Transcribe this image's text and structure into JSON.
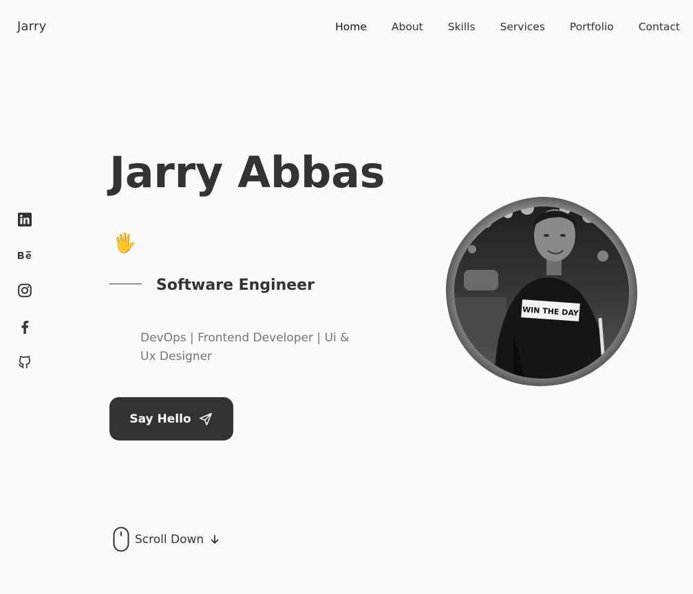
{
  "header": {
    "logo": "Jarry",
    "nav": [
      {
        "label": "Home",
        "active": true
      },
      {
        "label": "About",
        "active": false
      },
      {
        "label": "Skills",
        "active": false
      },
      {
        "label": "Services",
        "active": false
      },
      {
        "label": "Portfolio",
        "active": false
      },
      {
        "label": "Contact",
        "active": false
      }
    ]
  },
  "socials": [
    {
      "icon": "linkedin-icon"
    },
    {
      "icon": "behance-icon"
    },
    {
      "icon": "instagram-icon"
    },
    {
      "icon": "facebook-icon"
    },
    {
      "icon": "github-icon"
    }
  ],
  "hero": {
    "name": "Jarry Abbas",
    "wave_emoji": "🖐",
    "subtitle": "Software Engineer",
    "description": "DevOps | Frontend Developer | Ui & Ux Designer",
    "button_label": "Say Hello",
    "scroll_label": "Scroll Down",
    "avatar_shirt_text": "WIN THE DAY"
  },
  "colors": {
    "background": "#fafafa",
    "text": "#333333",
    "muted": "#757575",
    "button": "#333333"
  }
}
